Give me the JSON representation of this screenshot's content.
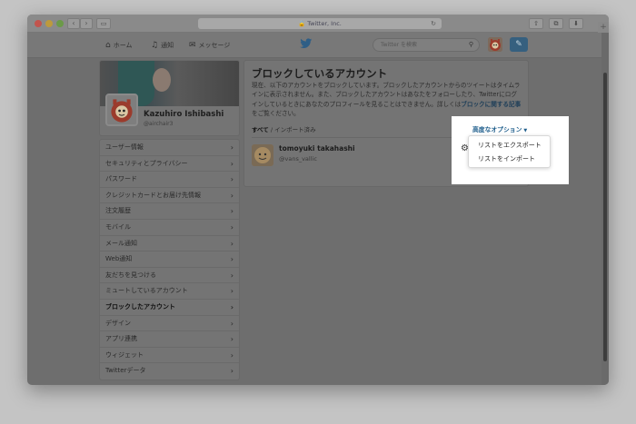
{
  "browser": {
    "url": "Twitter, Inc.",
    "back_icon": "chevron-left",
    "forward_icon": "chevron-right"
  },
  "nav": {
    "home": "ホーム",
    "notifications": "通知",
    "messages": "メッセージ",
    "search_placeholder": "Twitter を検索"
  },
  "profile": {
    "name": "Kazuhiro Ishibashi",
    "handle": "@airchair3"
  },
  "settings": {
    "items": [
      "ユーザー情報",
      "セキュリティとプライバシー",
      "パスワード",
      "クレジットカードとお届け先情報",
      "注文履歴",
      "モバイル",
      "メール通知",
      "Web通知",
      "友だちを見つける",
      "ミュートしているアカウント",
      "ブロックしたアカウント",
      "デザイン",
      "アプリ連携",
      "ウィジェット",
      "Twitterデータ"
    ],
    "active_index": 10
  },
  "main": {
    "title": "ブロックしているアカウント",
    "desc_part1": "現在、以下のアカウントをブロックしています。ブロックしたアカウントからのツイートはタイムラインに表示されません。また、ブロックしたアカウントはあなたをフォローしたり、Twitterにログインしているときにあなたのプロフィールを見ることはできません。詳しくは",
    "desc_link": "ブロックに関する記事",
    "desc_part2": "をご覧ください。",
    "filter_all": "すべて",
    "filter_sep": " / ",
    "filter_imported": "インポート済み"
  },
  "blocked_user": {
    "name": "tomoyuki takahashi",
    "handle": "@vans_vallic"
  },
  "advanced": {
    "button_label": "高度なオプション",
    "menu_export": "リストをエクスポート",
    "menu_import": "リストをインポート"
  },
  "colors": {
    "link": "#1f5e8c",
    "compose_button": "#36607f"
  }
}
